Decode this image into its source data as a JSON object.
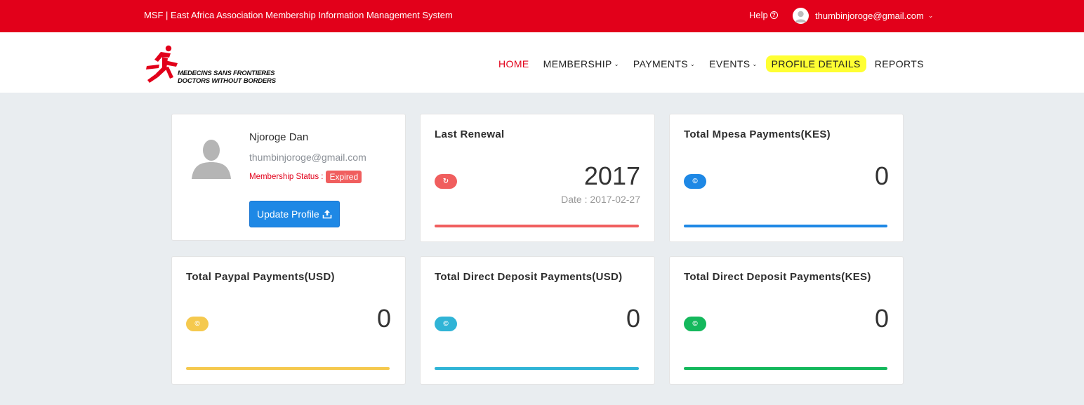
{
  "topbar": {
    "title": "MSF | East Africa Association Membership Information Management System",
    "help": "Help",
    "user_email": "thumbinjoroge@gmail.com"
  },
  "logo": {
    "line1": "MEDECINS SANS FRONTIERES",
    "line2": "DOCTORS WITHOUT BORDERS",
    "color": "#e2001a"
  },
  "nav": {
    "home": "HOME",
    "membership": "MEMBERSHIP",
    "payments": "PAYMENTS",
    "events": "EVENTS",
    "profile_details": "PROFILE DETAILS",
    "reports": "REPORTS"
  },
  "profile": {
    "name": "Njoroge Dan",
    "email": "thumbinjoroge@gmail.com",
    "status_label": "Membership Status :",
    "status_value": "Expired",
    "update_button": "Update Profile"
  },
  "cards": {
    "last_renewal": {
      "title": "Last Renewal",
      "value": "2017",
      "date": "Date : 2017-02-27",
      "color": "#f05e5e"
    },
    "mpesa": {
      "title": "Total Mpesa Payments(KES)",
      "value": "0",
      "color": "#1e88e5"
    },
    "paypal": {
      "title": "Total Paypal Payments(USD)",
      "value": "0",
      "color": "#f5c94e"
    },
    "deposit_usd": {
      "title": "Total Direct Deposit Payments(USD)",
      "value": "0",
      "color": "#30b4d6"
    },
    "deposit_kes": {
      "title": "Total Direct Deposit Payments(KES)",
      "value": "0",
      "color": "#14b85c"
    }
  }
}
